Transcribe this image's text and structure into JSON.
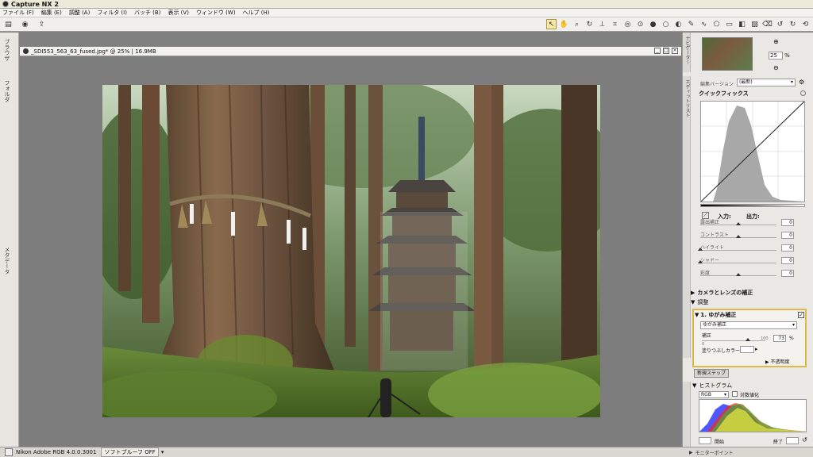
{
  "app": {
    "title": "Capture NX 2"
  },
  "menu": [
    "ファイル (F)",
    "編集 (E)",
    "調整 (A)",
    "フィルタ (I)",
    "バッチ (B)",
    "表示 (V)",
    "ウィンドウ (W)",
    "ヘルプ (H)"
  ],
  "toolbar": {
    "left_icons": [
      "display-mode-icon",
      "browser-icon",
      "open-icon"
    ],
    "right_icons": [
      "direct-select-icon",
      "hand-icon",
      "zoom-icon",
      "rotate-icon",
      "straighten-icon",
      "crop-icon",
      "red-eye-icon",
      "color-control-point-icon",
      "black-point-icon",
      "white-point-icon",
      "neutral-point-icon",
      "selection-brush-icon",
      "lasso-icon",
      "polygon-lasso-icon",
      "marquee-icon",
      "gradient-icon",
      "fill-icon",
      "eraser-icon",
      "rotate-left-icon",
      "rotate-right-icon",
      "undo-icon",
      "redo-icon"
    ]
  },
  "left_dock": {
    "tabs": [
      "ブラウザ",
      "フォルダ",
      "メタデータ"
    ]
  },
  "document": {
    "title": "_SDI553_563_63_fused.jpg* @ 25% | 16.9MB"
  },
  "photo": {
    "description_icon": "forest-pagoda-photo"
  },
  "status": {
    "profile": "Nikon Adobe RGB 4.0.0.3001",
    "softproof": "ソフトプルーフ OFF"
  },
  "navigator": {
    "zoom": "25",
    "unit": "%"
  },
  "edit_list": {
    "version_label": "編集バージョン",
    "version_value": "(最新)"
  },
  "quickfix": {
    "title": "クイックフィックス",
    "input_label": "入力:",
    "output_label": "出力:",
    "sliders": [
      {
        "label": "露出補正",
        "value": "0",
        "pos": 0.5
      },
      {
        "label": "コントラスト",
        "value": "0",
        "pos": 0.5
      },
      {
        "label": "ハイライト",
        "value": "0",
        "pos": 0.0
      },
      {
        "label": "シャドー",
        "value": "0",
        "pos": 0.0
      },
      {
        "label": "彩度",
        "value": "0",
        "pos": 0.5
      }
    ]
  },
  "camera_lens": {
    "title": "カメラとレンズの補正"
  },
  "adjust": {
    "title": "調整",
    "step_title": "1. ゆがみ補正",
    "dropdown": "ゆがみ補正",
    "amount_label": "補正",
    "amount_value": "73",
    "amount_unit": "%",
    "amount_min": "0",
    "amount_max": "100",
    "fill_label": "塗りつぶしカラー",
    "opacity_label": "不透明度"
  },
  "new_step": "新規ステップ",
  "histogram": {
    "title": "ヒストグラム",
    "channel": "RGB",
    "log_label": "対数値化",
    "start_label": "開始",
    "end_label": "終了"
  },
  "monitor_points": "モニターポイント"
}
